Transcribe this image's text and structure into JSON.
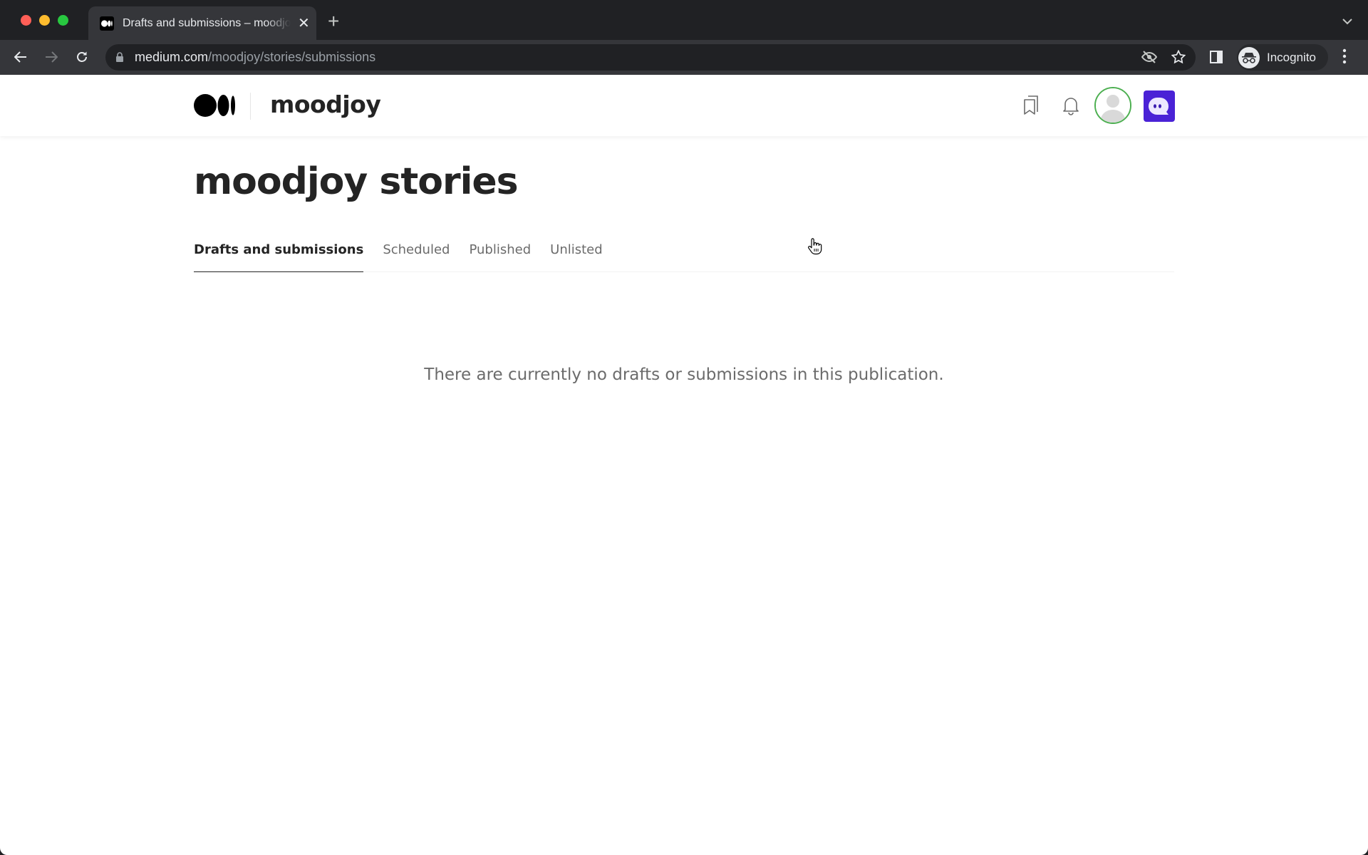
{
  "browser": {
    "tab": {
      "title": "Drafts and submissions – moodjoy stories – Medium",
      "favicon": "medium-logo-icon",
      "close_icon": "close-icon"
    },
    "new_tab_icon": "plus-icon",
    "tab_list_icon": "chevron-down-icon",
    "nav": {
      "back_icon": "arrow-left-icon",
      "forward_icon": "arrow-right-icon",
      "reload_icon": "reload-icon"
    },
    "address_bar": {
      "lock_icon": "lock-icon",
      "host": "medium.com",
      "path": "/moodjoy/stories/submissions",
      "tracking_icon": "eye-off-icon",
      "bookmark_icon": "star-icon"
    },
    "side_panel_icon": "side-panel-icon",
    "profile": {
      "icon": "incognito-icon",
      "label": "Incognito"
    },
    "menu_icon": "more-vertical-icon"
  },
  "site_header": {
    "logo": "medium-logo",
    "publication_name": "moodjoy",
    "lists_icon": "bookmarks-icon",
    "notifications_icon": "bell-icon",
    "user_avatar": "default-user-avatar",
    "app_avatar": "ghost-chat-icon",
    "colors": {
      "avatar_ring": "#4caf50",
      "app_avatar_bg": "#4a22d6"
    }
  },
  "main": {
    "title": "moodjoy stories",
    "tabs": [
      {
        "label": "Drafts and submissions",
        "active": true
      },
      {
        "label": "Scheduled",
        "active": false
      },
      {
        "label": "Published",
        "active": false
      },
      {
        "label": "Unlisted",
        "active": false
      }
    ],
    "empty_message": "There are currently no drafts or submissions in this publication."
  }
}
